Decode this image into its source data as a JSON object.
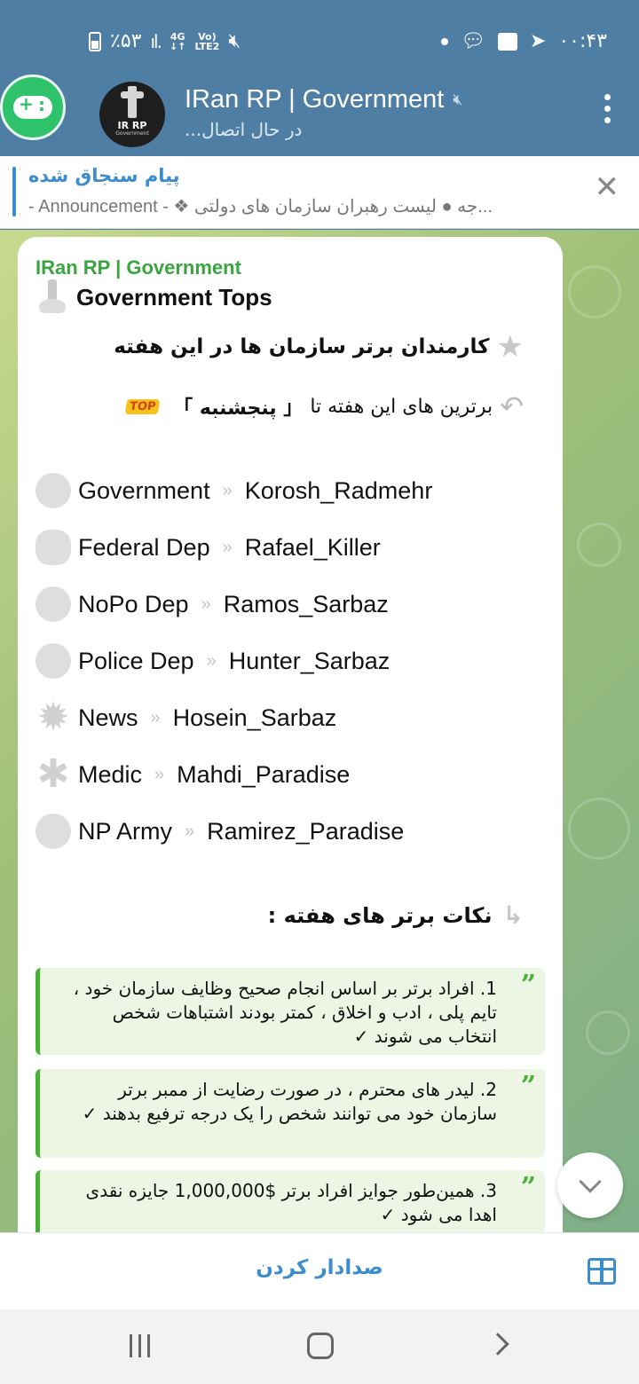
{
  "status": {
    "battery": "٪۵۳",
    "network": "4G",
    "volte": "Vo) LTE2",
    "time": "۰۰:۴۳"
  },
  "header": {
    "title": "IRan RP | Government",
    "subtitle": "در حال اتصال...",
    "avatar_text": "IR RP",
    "avatar_subtext": "Government"
  },
  "pinned": {
    "title": "پیام سنجاق شده",
    "text": "- Announcement -  ❖ جه  ●  لیست رهبران سازمان های دولتی..."
  },
  "message": {
    "sender": "IRan RP | Government",
    "heading": "Government Tops",
    "line1": "کارمندان برتر سازمان ها در این هفته",
    "line2_prefix": "برترین های این هفته تا",
    "line2_day": "「 پنجشنبه 」",
    "top_badge": "TOP",
    "rows": [
      {
        "dept": "Government",
        "name": "Korosh_Radmehr"
      },
      {
        "dept": "Federal Dep",
        "name": "Rafael_Killer"
      },
      {
        "dept": "NoPo Dep",
        "name": "Ramos_Sarbaz"
      },
      {
        "dept": "Police Dep",
        "name": "Hunter_Sarbaz"
      },
      {
        "dept": "News",
        "name": "Hosein_Sarbaz"
      },
      {
        "dept": "Medic",
        "name": "Mahdi_Paradise"
      },
      {
        "dept": "NP Army",
        "name": "Ramirez_Paradise"
      }
    ],
    "tips_heading": "نکات برتر های هفته :",
    "tips": [
      "1. افراد برتر بر اساس انجام صحیح وظایف سازمان خود ، تایم پلی ، ادب و اخلاق ، کمتر بودند اشتباهات شخص انتخاب می شوند ✓",
      "2. لیدر های محترم ، در صورت رضایت از ممبر برتر سازمان خود می توانند شخص را یک درجه ترفیع بدهند ✓",
      "3. همین‌طور جوایز افراد برتر $1,000,000 جایزه نقدی اهدا می شود ✓"
    ]
  },
  "bottom": {
    "unmute_label": "صدادار کردن"
  },
  "icons": {
    "game": "gamepad-icon",
    "close": "close-icon",
    "scroll": "chevron-down-icon",
    "gift": "gift-icon"
  }
}
